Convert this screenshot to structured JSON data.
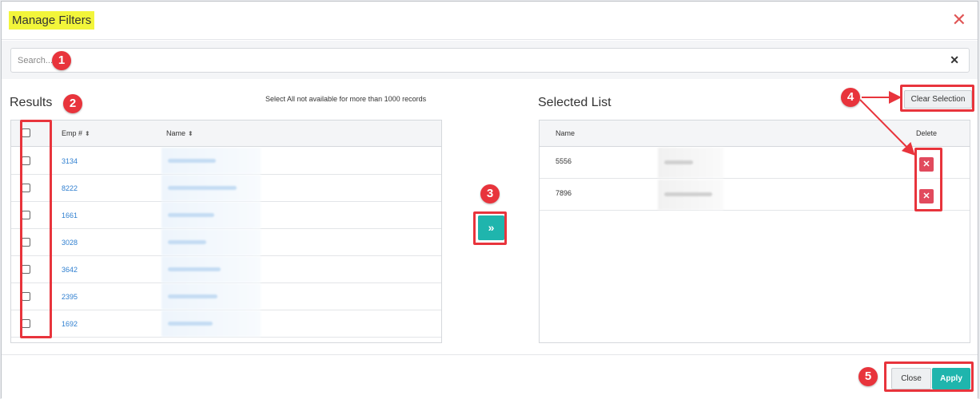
{
  "dialog": {
    "title": "Manage Filters"
  },
  "search": {
    "placeholder": "Search...",
    "value": ""
  },
  "results": {
    "title": "Results",
    "note": "Select All not available for more than 1000 records",
    "columns": {
      "emp": "Emp #",
      "name": "Name"
    },
    "rows": [
      {
        "emp": "3134"
      },
      {
        "emp": "8222"
      },
      {
        "emp": "1661"
      },
      {
        "emp": "3028"
      },
      {
        "emp": "3642"
      },
      {
        "emp": "2395"
      },
      {
        "emp": "1692"
      }
    ]
  },
  "transfer_button": {
    "label": "»"
  },
  "selected": {
    "title": "Selected List",
    "clear_label": "Clear Selection",
    "columns": {
      "name": "Name",
      "delete": "Delete"
    },
    "rows": [
      {
        "id": "5556"
      },
      {
        "id": "7896"
      }
    ]
  },
  "footer": {
    "close_label": "Close",
    "apply_label": "Apply"
  },
  "annotations": [
    "1",
    "2",
    "3",
    "4",
    "5"
  ],
  "icons": {
    "close": "close-icon",
    "sort": "sort-icon",
    "delete": "delete-icon",
    "transfer": "double-chevron-right-icon"
  },
  "colors": {
    "accent": "#1fb5ad",
    "danger": "#e14a5d",
    "annotation": "#e8343c",
    "highlight": "#f2f53a",
    "link": "#2f7fd0"
  }
}
